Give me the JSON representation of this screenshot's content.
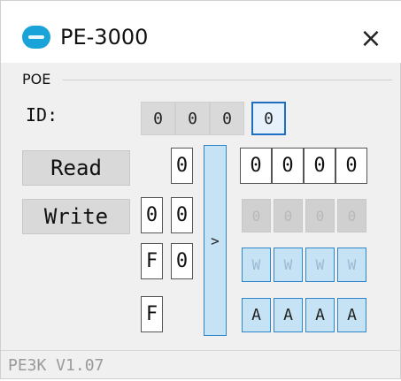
{
  "window": {
    "title": "PE-3000",
    "close_glyph": "×",
    "app_icon": "app-logo-icon"
  },
  "group": {
    "label": "POE"
  },
  "id": {
    "label": "ID:",
    "digits": [
      "0",
      "0",
      "0",
      "0"
    ],
    "active_index": 3
  },
  "buttons": {
    "read": "Read",
    "write": "Write",
    "transfer": ">"
  },
  "left_columns": {
    "col_a": [
      "0",
      "F",
      "F"
    ],
    "col_b": [
      "0",
      "0",
      "0"
    ]
  },
  "right_grid": {
    "row_read": [
      "0",
      "0",
      "0",
      "0"
    ],
    "row_disabled": [
      "0",
      "0",
      "0",
      "0"
    ],
    "row_w": [
      "W",
      "W",
      "W",
      "W"
    ],
    "row_a": [
      "A",
      "A",
      "A",
      "A"
    ]
  },
  "status": {
    "version": "PE3K V1.07"
  },
  "colors": {
    "accent": "#2e86c8",
    "highlight_fill": "#c6e2f5",
    "button_gray": "#d9d9d9"
  }
}
